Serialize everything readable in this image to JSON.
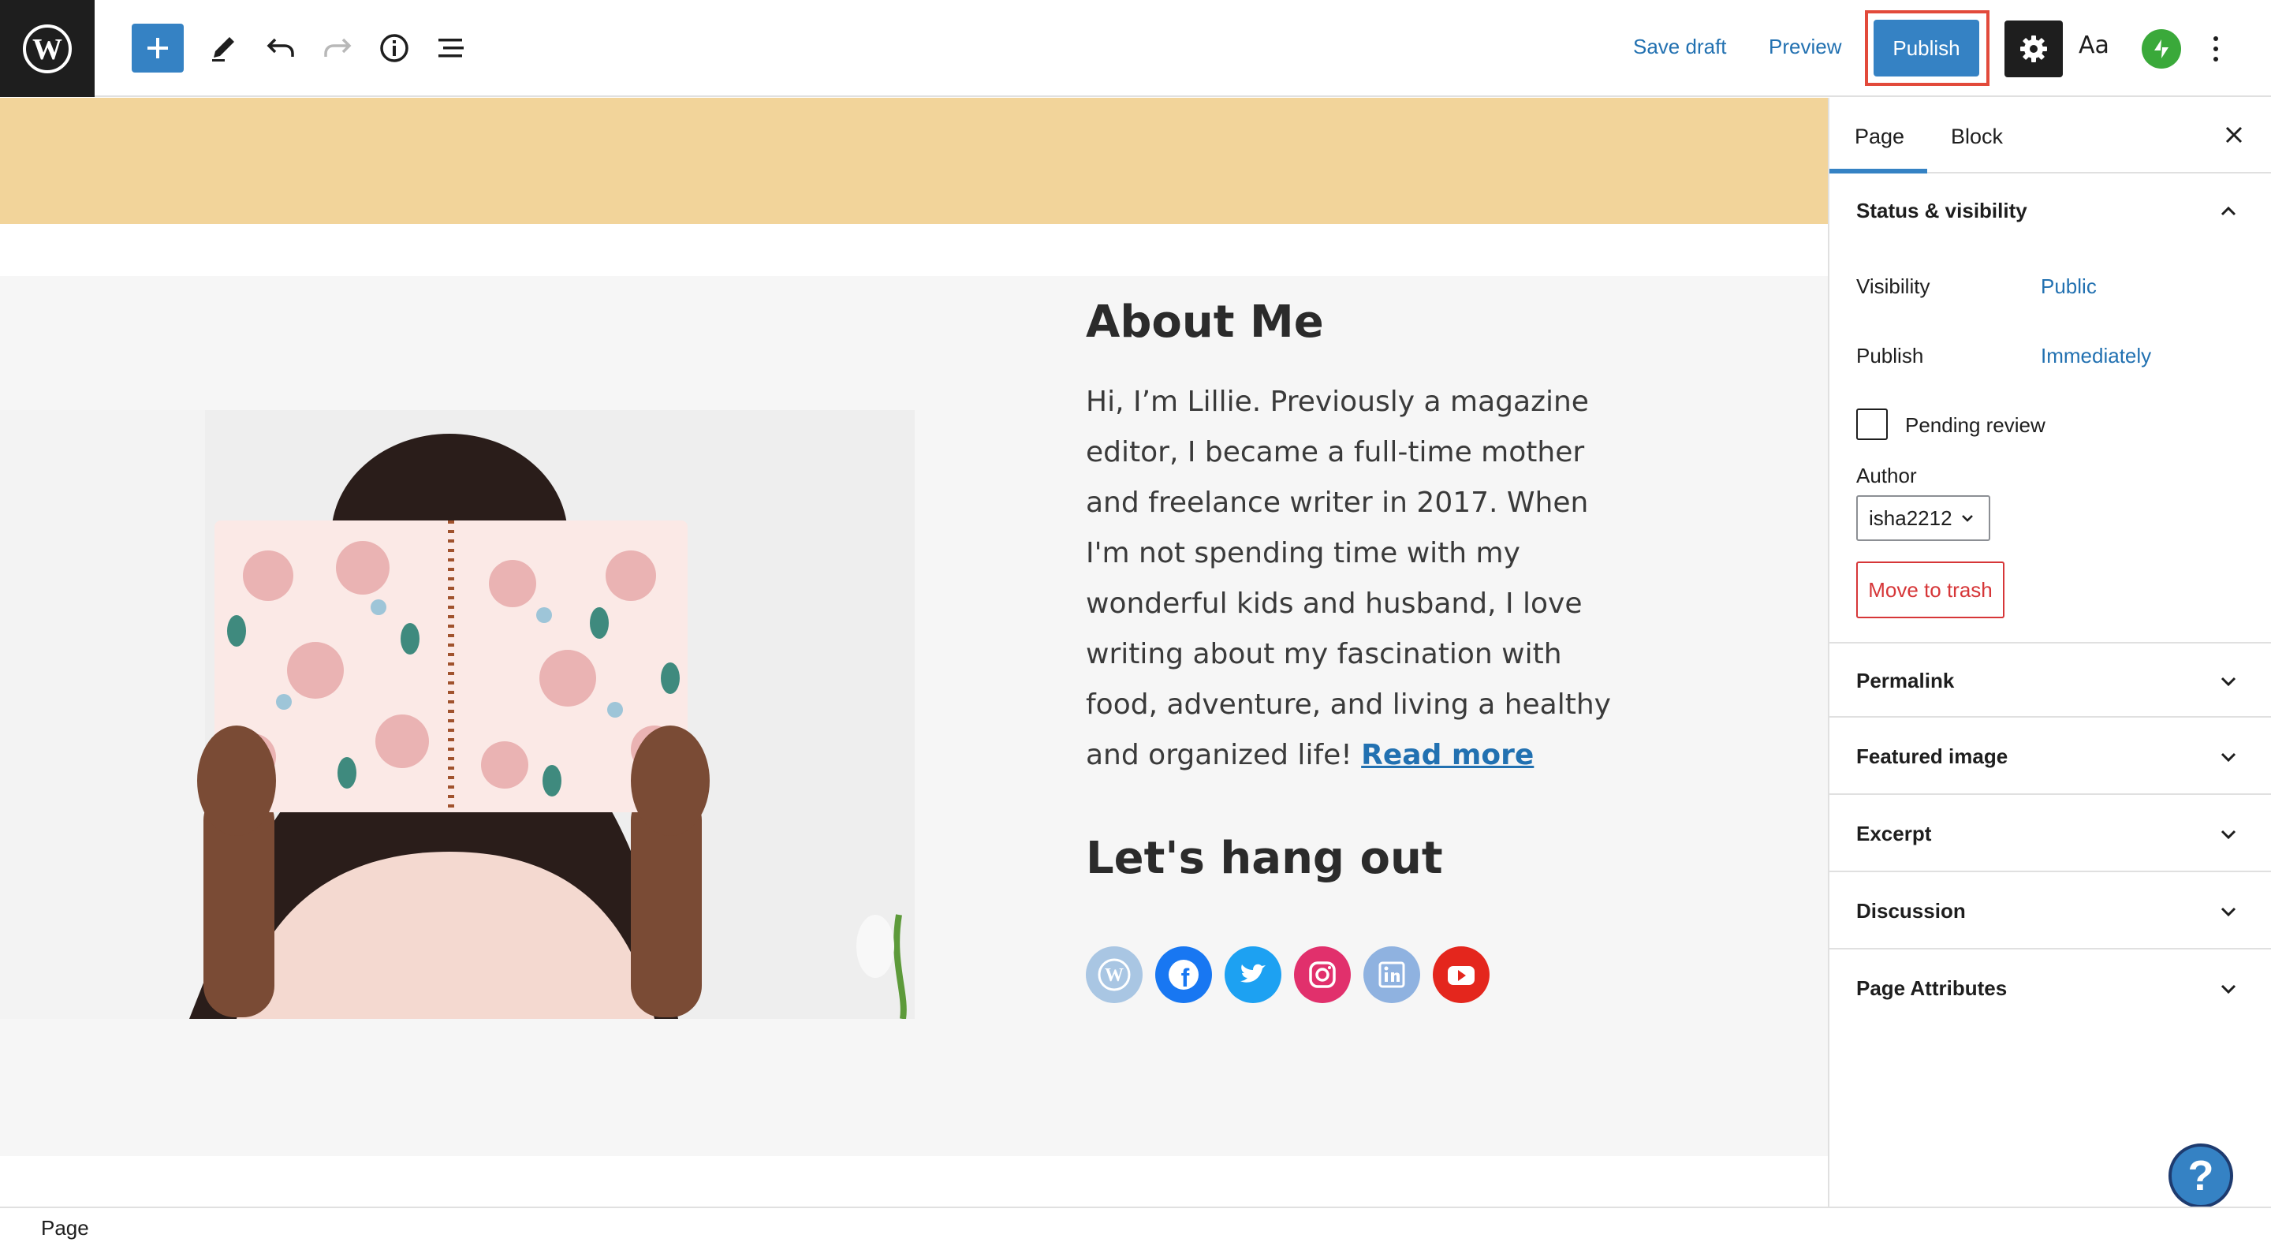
{
  "toolbar": {
    "save_draft": "Save draft",
    "preview": "Preview",
    "publish": "Publish",
    "styles": "Aa",
    "icons": [
      "wordpress-logo-icon",
      "plus-icon",
      "pencil-icon",
      "undo-icon",
      "redo-icon",
      "info-icon",
      "list-view-icon",
      "gear-icon",
      "jetpack-icon",
      "more-vertical-icon"
    ]
  },
  "content": {
    "about_title": "About Me",
    "about_body": "Hi, I’m Lillie. Previously a magazine editor, I became a full-time mother and freelance writer in 2017. When I'm not spending time with my wonderful kids and husband, I love writing about my fascination with food, adventure, and living a healthy and organized life!",
    "read_more": "Read more",
    "hang_title": "Let's hang out",
    "social": [
      {
        "name": "wordpress",
        "color": "#a9c6e3"
      },
      {
        "name": "facebook",
        "color": "#1877f2"
      },
      {
        "name": "twitter",
        "color": "#1da1f2"
      },
      {
        "name": "instagram",
        "color": "#e1306c"
      },
      {
        "name": "linkedin",
        "color": "#8fb2e0"
      },
      {
        "name": "youtube",
        "color": "#e4261d"
      }
    ]
  },
  "sidebar": {
    "tab_page": "Page",
    "tab_block": "Block",
    "status": {
      "title": "Status & visibility",
      "visibility_label": "Visibility",
      "visibility_value": "Public",
      "publish_label": "Publish",
      "publish_value": "Immediately",
      "pending_review": "Pending review",
      "author_label": "Author",
      "author_value": "isha2212",
      "trash": "Move to trash"
    },
    "panels": [
      "Permalink",
      "Featured image",
      "Excerpt",
      "Discussion",
      "Page Attributes"
    ]
  },
  "help": "?",
  "footer": {
    "breadcrumb": "Page"
  },
  "colors": {
    "accent": "#3582c4",
    "link": "#2271b1",
    "banner": "#f2d49a",
    "danger": "#d63638",
    "highlight": "#e24a3b"
  }
}
